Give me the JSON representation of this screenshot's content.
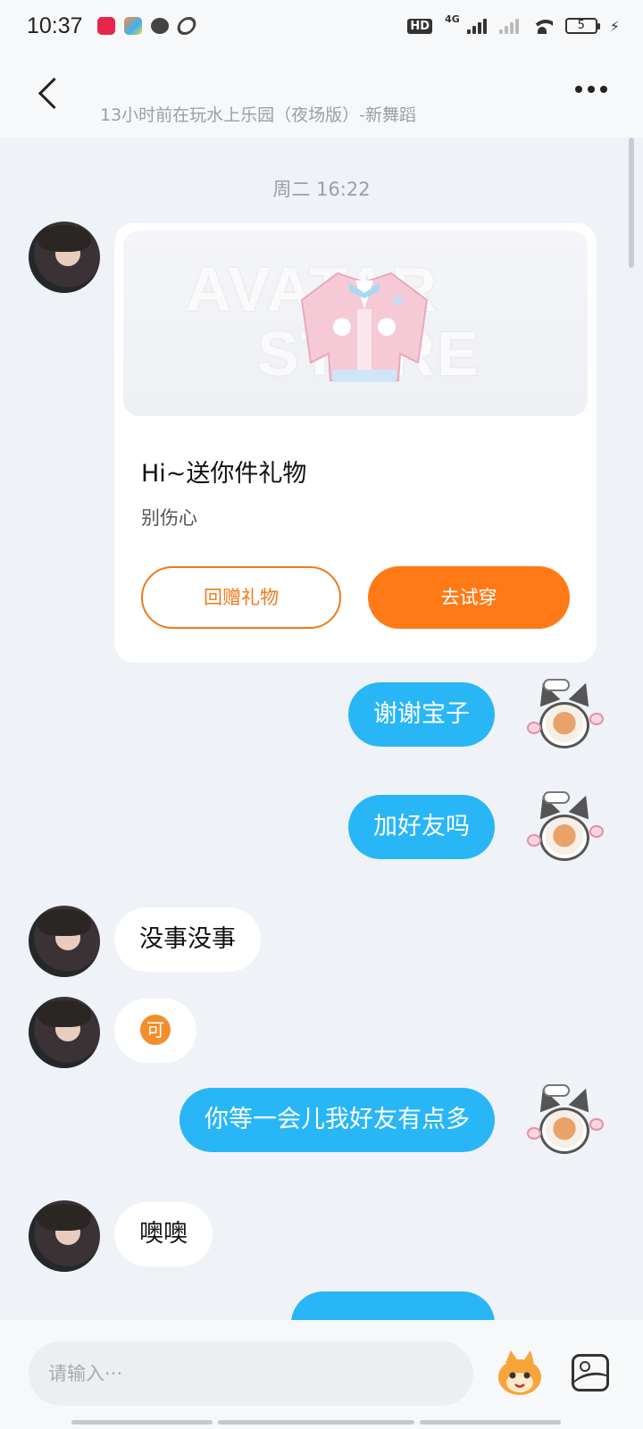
{
  "status_bar": {
    "time": "10:37",
    "network": "4G",
    "battery": "5"
  },
  "header": {
    "subtitle": "13小时前在玩水上乐园（夜场版）-新舞蹈"
  },
  "chat": {
    "timestamp": "周二 16:22",
    "gift_card": {
      "watermark_line1": "AVATAR",
      "watermark_line2": "STORE",
      "title": "Hi~送你件礼物",
      "message": "别伤心",
      "return_gift_label": "回赠礼物",
      "try_on_label": "去试穿"
    },
    "messages": [
      {
        "side": "right",
        "text": "谢谢宝子"
      },
      {
        "side": "right",
        "text": "加好友吗"
      },
      {
        "side": "left",
        "text": "没事没事"
      },
      {
        "side": "left",
        "emoji": "可"
      },
      {
        "side": "right",
        "text": "你等一会儿我好友有点多"
      },
      {
        "side": "left",
        "text": "噢噢"
      }
    ]
  },
  "input": {
    "placeholder": "请输入···"
  },
  "colors": {
    "accent_orange": "#ff7a16",
    "bubble_blue": "#29b6f6",
    "background": "#eff2f6"
  }
}
